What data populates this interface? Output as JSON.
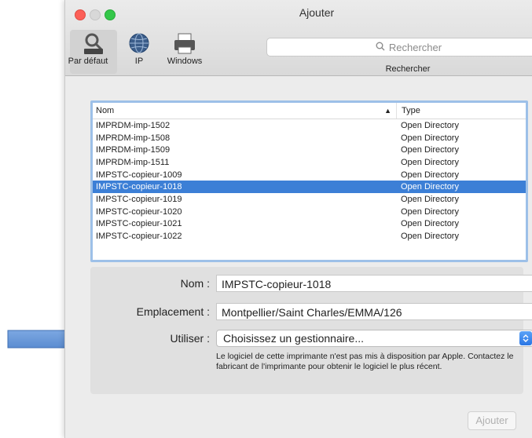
{
  "window": {
    "title": "Ajouter"
  },
  "toolbar": {
    "buttons": [
      {
        "label": "Par défaut",
        "icon": "printer-default-icon"
      },
      {
        "label": "IP",
        "icon": "globe-icon"
      },
      {
        "label": "Windows",
        "icon": "windows-printer-icon"
      }
    ],
    "search_placeholder": "Rechercher",
    "search_caption": "Rechercher"
  },
  "printer_list": {
    "columns": [
      "Nom",
      "Type"
    ],
    "rows": [
      {
        "name": "IMPRDM-imp-1502",
        "type": "Open Directory"
      },
      {
        "name": "IMPRDM-imp-1508",
        "type": "Open Directory"
      },
      {
        "name": "IMPRDM-imp-1509",
        "type": "Open Directory"
      },
      {
        "name": "IMPRDM-imp-1511",
        "type": "Open Directory"
      },
      {
        "name": "IMPSTC-copieur-1009",
        "type": "Open Directory"
      },
      {
        "name": "IMPSTC-copieur-1018",
        "type": "Open Directory",
        "selected": true
      },
      {
        "name": "IMPSTC-copieur-1019",
        "type": "Open Directory"
      },
      {
        "name": "IMPSTC-copieur-1020",
        "type": "Open Directory"
      },
      {
        "name": "IMPSTC-copieur-1021",
        "type": "Open Directory"
      },
      {
        "name": "IMPSTC-copieur-1022",
        "type": "Open Directory"
      }
    ]
  },
  "form": {
    "name_label": "Nom :",
    "name_value": "IMPSTC-copieur-1018",
    "location_label": "Emplacement :",
    "location_value": "Montpellier/Saint Charles/EMMA/126",
    "use_label": "Utiliser :",
    "use_value": "Choisissez un gestionnaire...",
    "note": "Le logiciel de cette imprimante n'est pas mis à disposition par Apple. Contactez le fabricant de l'imprimante pour obtenir le logiciel le plus récent."
  },
  "buttons": {
    "add": "Ajouter"
  },
  "colors": {
    "selection": "#3c7fd6",
    "annotation_arrow": "#5b8fd6"
  }
}
